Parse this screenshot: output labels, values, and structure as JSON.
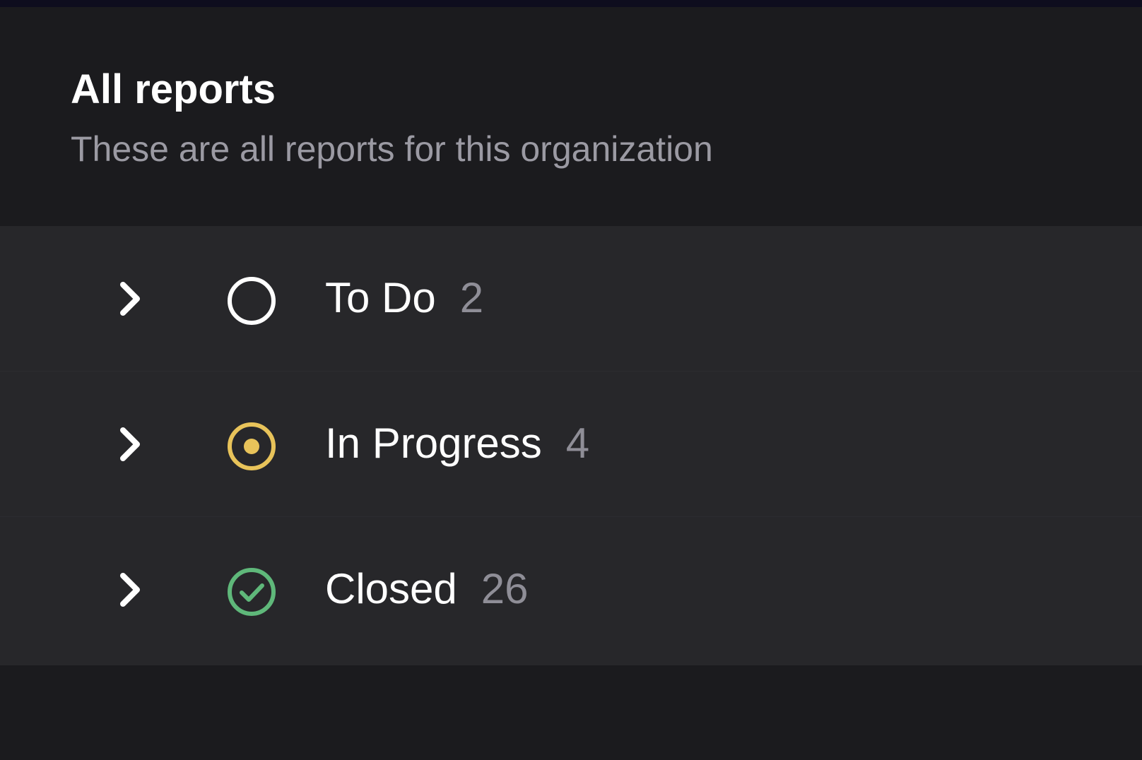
{
  "header": {
    "title": "All reports",
    "subtitle": "These are all reports for this organization"
  },
  "groups": [
    {
      "label": "To Do",
      "count": "2",
      "status_icon": "circle-outline-icon",
      "color": "#ffffff"
    },
    {
      "label": "In Progress",
      "count": "4",
      "status_icon": "circle-dot-icon",
      "color": "#e8c35a"
    },
    {
      "label": "Closed",
      "count": "26",
      "status_icon": "check-circle-icon",
      "color": "#5fb87a"
    }
  ],
  "colors": {
    "background": "#1b1b1e",
    "panel": "#27272a",
    "text_primary": "#ffffff",
    "text_secondary": "#9b9aa3"
  }
}
